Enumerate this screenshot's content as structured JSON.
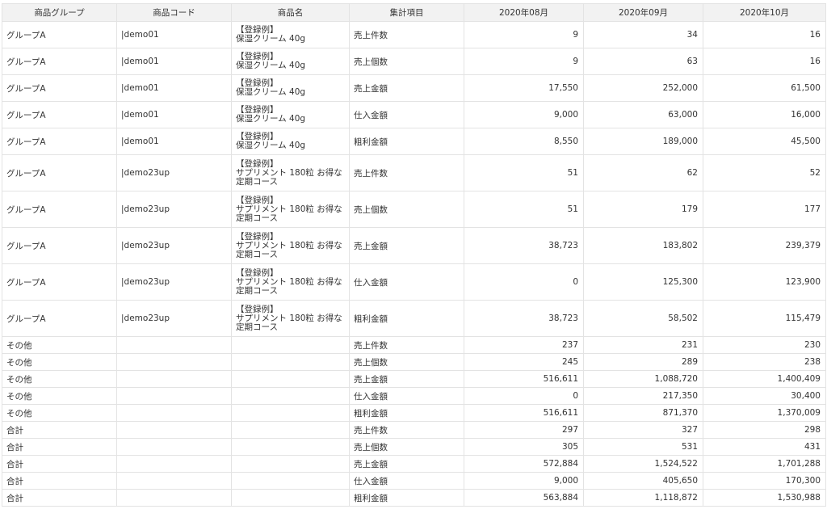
{
  "headers": [
    "商品グループ",
    "商品コード",
    "商品名",
    "集計項目",
    "2020年08月",
    "2020年09月",
    "2020年10月"
  ],
  "rows": [
    {
      "group": "グループA",
      "code": "|demo01",
      "name": [
        "【登録例】",
        "保湿クリーム 40g"
      ],
      "item": "売上件数",
      "m08": "9",
      "m09": "34",
      "m10": "16"
    },
    {
      "group": "グループA",
      "code": "|demo01",
      "name": [
        "【登録例】",
        "保湿クリーム 40g"
      ],
      "item": "売上個数",
      "m08": "9",
      "m09": "63",
      "m10": "16"
    },
    {
      "group": "グループA",
      "code": "|demo01",
      "name": [
        "【登録例】",
        "保湿クリーム 40g"
      ],
      "item": "売上金額",
      "m08": "17,550",
      "m09": "252,000",
      "m10": "61,500"
    },
    {
      "group": "グループA",
      "code": "|demo01",
      "name": [
        "【登録例】",
        "保湿クリーム 40g"
      ],
      "item": "仕入金額",
      "m08": "9,000",
      "m09": "63,000",
      "m10": "16,000"
    },
    {
      "group": "グループA",
      "code": "|demo01",
      "name": [
        "【登録例】",
        "保湿クリーム 40g"
      ],
      "item": "粗利金額",
      "m08": "8,550",
      "m09": "189,000",
      "m10": "45,500"
    },
    {
      "group": "グループA",
      "code": "|demo23up",
      "name": [
        "【登録例】",
        "サプリメント 180粒 お得な",
        "定期コース"
      ],
      "item": "売上件数",
      "m08": "51",
      "m09": "62",
      "m10": "52"
    },
    {
      "group": "グループA",
      "code": "|demo23up",
      "name": [
        "【登録例】",
        "サプリメント 180粒 お得な",
        "定期コース"
      ],
      "item": "売上個数",
      "m08": "51",
      "m09": "179",
      "m10": "177"
    },
    {
      "group": "グループA",
      "code": "|demo23up",
      "name": [
        "【登録例】",
        "サプリメント 180粒 お得な",
        "定期コース"
      ],
      "item": "売上金額",
      "m08": "38,723",
      "m09": "183,802",
      "m10": "239,379"
    },
    {
      "group": "グループA",
      "code": "|demo23up",
      "name": [
        "【登録例】",
        "サプリメント 180粒 お得な",
        "定期コース"
      ],
      "item": "仕入金額",
      "m08": "0",
      "m09": "125,300",
      "m10": "123,900"
    },
    {
      "group": "グループA",
      "code": "|demo23up",
      "name": [
        "【登録例】",
        "サプリメント 180粒 お得な",
        "定期コース"
      ],
      "item": "粗利金額",
      "m08": "38,723",
      "m09": "58,502",
      "m10": "115,479"
    },
    {
      "group": "その他",
      "code": "",
      "name": [],
      "item": "売上件数",
      "m08": "237",
      "m09": "231",
      "m10": "230"
    },
    {
      "group": "その他",
      "code": "",
      "name": [],
      "item": "売上個数",
      "m08": "245",
      "m09": "289",
      "m10": "238"
    },
    {
      "group": "その他",
      "code": "",
      "name": [],
      "item": "売上金額",
      "m08": "516,611",
      "m09": "1,088,720",
      "m10": "1,400,409"
    },
    {
      "group": "その他",
      "code": "",
      "name": [],
      "item": "仕入金額",
      "m08": "0",
      "m09": "217,350",
      "m10": "30,400"
    },
    {
      "group": "その他",
      "code": "",
      "name": [],
      "item": "粗利金額",
      "m08": "516,611",
      "m09": "871,370",
      "m10": "1,370,009"
    },
    {
      "group": "合計",
      "code": "",
      "name": [],
      "item": "売上件数",
      "m08": "297",
      "m09": "327",
      "m10": "298"
    },
    {
      "group": "合計",
      "code": "",
      "name": [],
      "item": "売上個数",
      "m08": "305",
      "m09": "531",
      "m10": "431"
    },
    {
      "group": "合計",
      "code": "",
      "name": [],
      "item": "売上金額",
      "m08": "572,884",
      "m09": "1,524,522",
      "m10": "1,701,288"
    },
    {
      "group": "合計",
      "code": "",
      "name": [],
      "item": "仕入金額",
      "m08": "9,000",
      "m09": "405,650",
      "m10": "170,300"
    },
    {
      "group": "合計",
      "code": "",
      "name": [],
      "item": "粗利金額",
      "m08": "563,884",
      "m09": "1,118,872",
      "m10": "1,530,988"
    }
  ]
}
